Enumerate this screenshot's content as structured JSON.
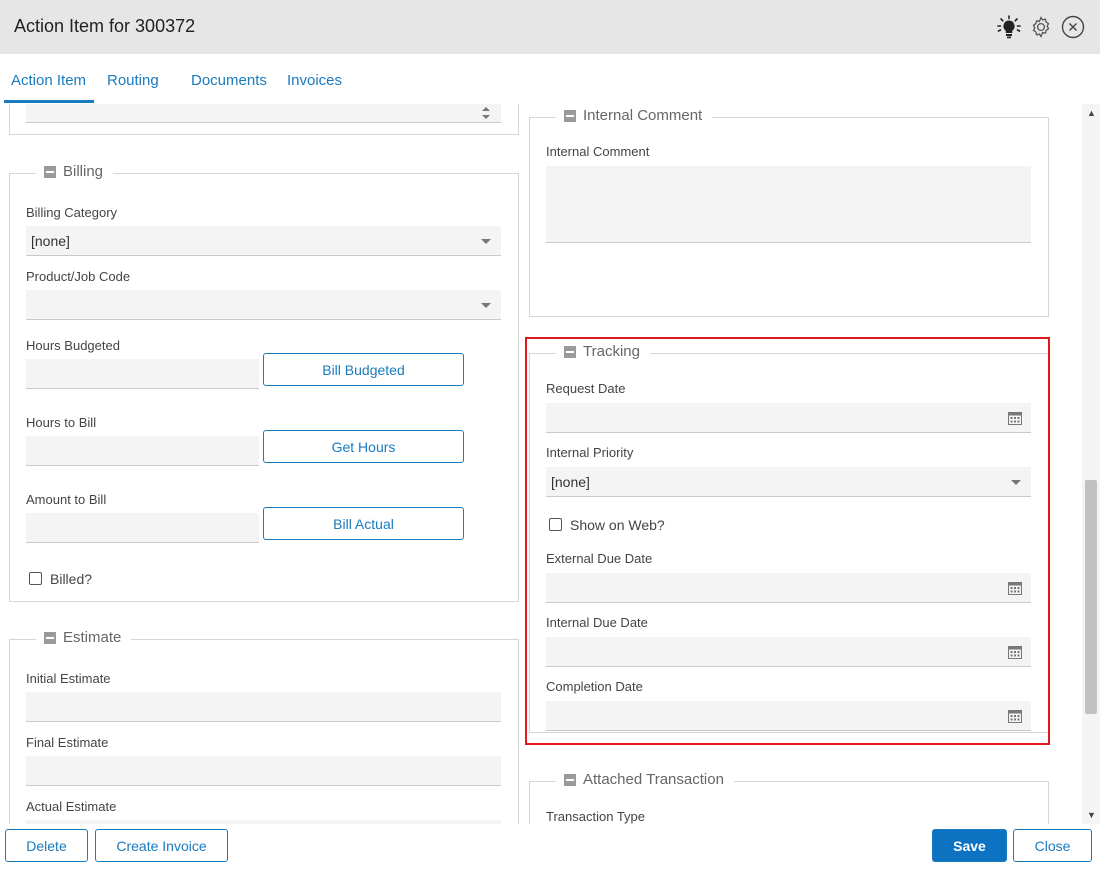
{
  "window": {
    "title": "Action Item for 300372"
  },
  "tabs": [
    {
      "label": "Action Item"
    },
    {
      "label": "Routing"
    },
    {
      "label": "Documents"
    },
    {
      "label": "Invoices"
    }
  ],
  "billing": {
    "legend": "Billing",
    "category_label": "Billing Category",
    "category_value": "[none]",
    "product_label": "Product/Job Code",
    "product_value": "",
    "hours_budgeted_label": "Hours Budgeted",
    "bill_budgeted_button": "Bill Budgeted",
    "hours_to_bill_label": "Hours to Bill",
    "get_hours_button": "Get Hours",
    "amount_to_bill_label": "Amount to Bill",
    "bill_actual_button": "Bill Actual",
    "billed_label": "Billed?"
  },
  "estimate": {
    "legend": "Estimate",
    "initial_label": "Initial Estimate",
    "final_label": "Final Estimate",
    "actual_label": "Actual Estimate"
  },
  "internal_comment": {
    "legend": "Internal Comment",
    "field_label": "Internal Comment"
  },
  "tracking": {
    "legend": "Tracking",
    "request_date_label": "Request Date",
    "internal_priority_label": "Internal Priority",
    "internal_priority_value": "[none]",
    "show_on_web_label": "Show on Web?",
    "external_due_label": "External Due Date",
    "internal_due_label": "Internal Due Date",
    "completion_label": "Completion Date"
  },
  "attached_transaction": {
    "legend": "Attached Transaction",
    "type_label": "Transaction Type"
  },
  "footer": {
    "delete": "Delete",
    "create_invoice": "Create Invoice",
    "save": "Save",
    "close": "Close"
  },
  "icons": {
    "lightbulb": "lightbulb-icon",
    "gear": "gear-icon",
    "close": "close-icon",
    "calendar": "calendar-icon"
  },
  "colors": {
    "accent": "#1a7bbf",
    "primary_button": "#0c73c2",
    "highlight": "#e0191e"
  }
}
